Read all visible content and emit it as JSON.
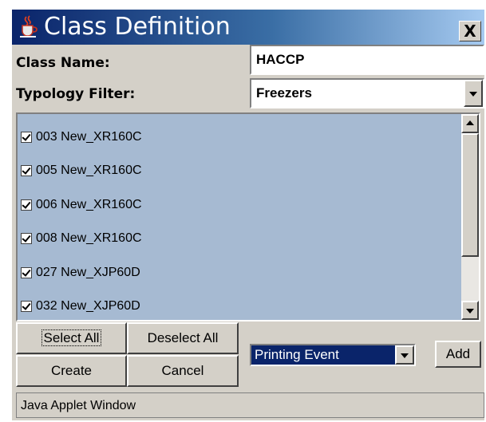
{
  "window": {
    "title": "Class Definition",
    "close_label": "X",
    "icon": "java-cup-icon"
  },
  "form": {
    "class_name_label": "Class Name:",
    "class_name_value": "HACCP",
    "typology_filter_label": "Typology Filter:",
    "typology_filter_value": "Freezers"
  },
  "devices": [
    {
      "label": "003 New_XR160C",
      "checked": true
    },
    {
      "label": "005 New_XR160C",
      "checked": true
    },
    {
      "label": "006 New_XR160C",
      "checked": true
    },
    {
      "label": "008 New_XR160C",
      "checked": true
    },
    {
      "label": "027 New_XJP60D",
      "checked": true
    },
    {
      "label": "032 New_XJP60D",
      "checked": true
    }
  ],
  "buttons": {
    "select_all": "Select All",
    "deselect_all": "Deselect All",
    "create": "Create",
    "cancel": "Cancel",
    "add": "Add"
  },
  "event_select": {
    "value": "Printing Event"
  },
  "status": "Java Applet Window",
  "colors": {
    "title_gradient_start": "#0a246a",
    "title_gradient_end": "#a6caf0",
    "list_background": "#a6bad2",
    "dialog_background": "#d4d0c8"
  }
}
